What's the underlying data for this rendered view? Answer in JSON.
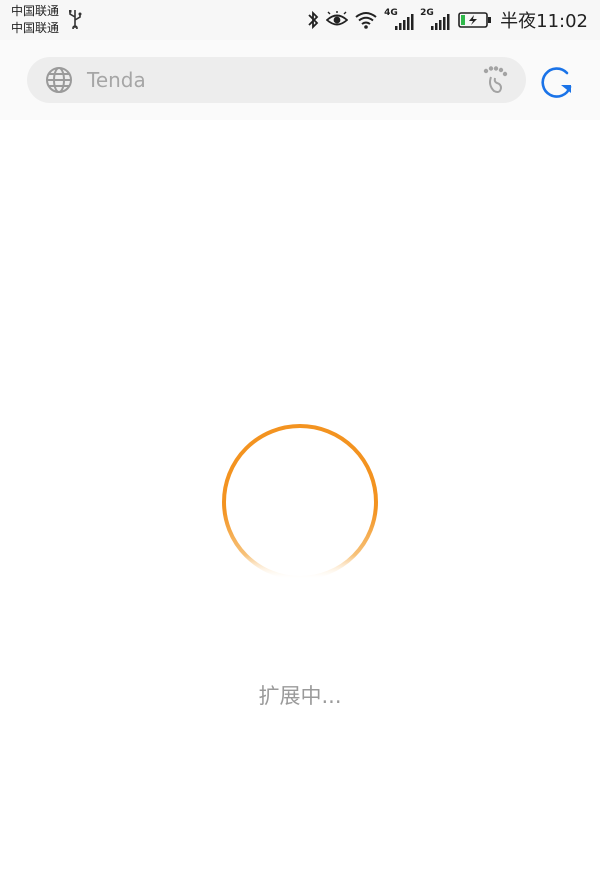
{
  "status_bar": {
    "carrier_1": "中国联通",
    "carrier_2": "中国联通",
    "network_1": "4G",
    "network_2": "2G",
    "time": "半夜11:02"
  },
  "browser": {
    "url_text": "Tenda"
  },
  "loading": {
    "label": "扩展中..."
  },
  "colors": {
    "spinner": "#f39320",
    "refresh": "#1a73e8"
  }
}
